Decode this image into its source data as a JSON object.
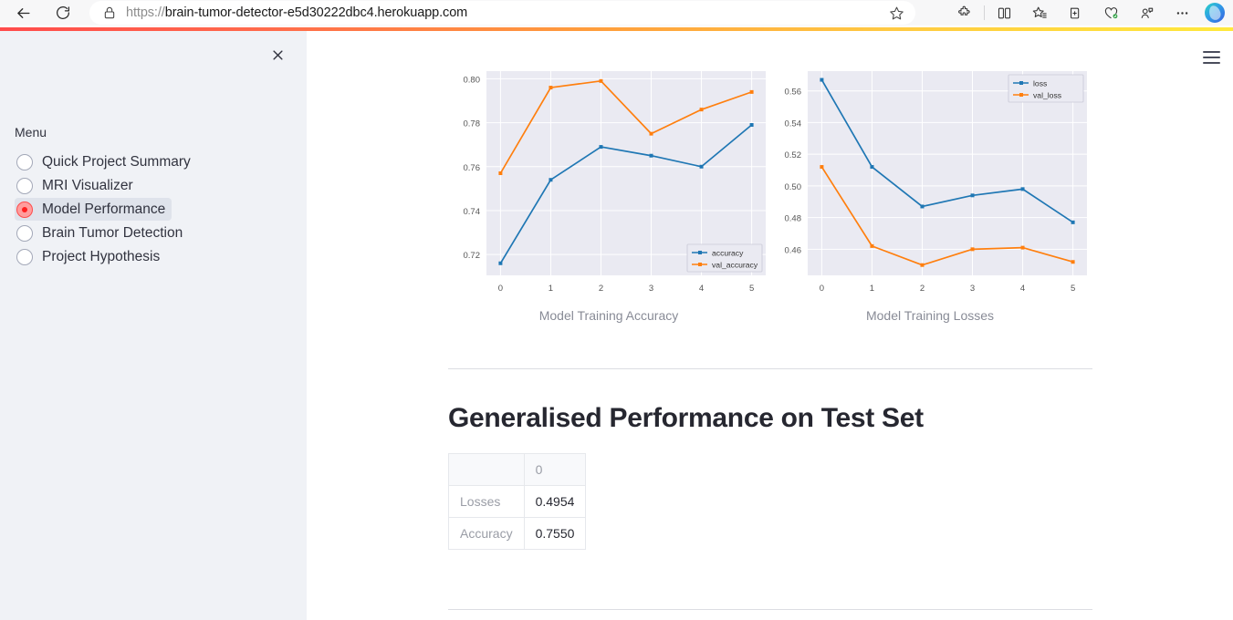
{
  "browser": {
    "url_scheme": "https://",
    "url_host": "brain-tumor-detector-e5d30222dbc4.herokuapp.com",
    "back_label": "Back",
    "reload_label": "Refresh",
    "lock_label": "Site information",
    "favorite_label": "Add this page to favorites",
    "icons": {
      "back": "back-arrow-icon",
      "reload": "reload-icon",
      "lock": "lock-icon",
      "star": "star-icon",
      "extensions": "puzzle-extensions-icon",
      "split_screen": "split-screen-icon",
      "favorites_list": "favorites-list-icon",
      "collections": "collections-add-icon",
      "browser_essentials": "browser-essentials-icon",
      "copilot_share": "copilot-share-icon",
      "settings_more": "ellipsis-more-icon",
      "copilot": "copilot-logo-icon"
    }
  },
  "sidebar": {
    "close_label": "×",
    "menu_label": "Menu",
    "items": [
      {
        "label": "Quick Project Summary",
        "selected": false
      },
      {
        "label": "MRI Visualizer",
        "selected": false
      },
      {
        "label": "Model Performance",
        "selected": true
      },
      {
        "label": "Brain Tumor Detection",
        "selected": false
      },
      {
        "label": "Project Hypothesis",
        "selected": false
      }
    ]
  },
  "main": {
    "hamburger_label": "Main menu",
    "section_title": "Generalised Performance on Test Set",
    "expand_icon": "fullscreen-expand-icon",
    "table": {
      "corner_header": "",
      "column_headers": [
        "0"
      ],
      "rows": [
        {
          "label": "Losses",
          "values": [
            "0.4954"
          ]
        },
        {
          "label": "Accuracy",
          "values": [
            "0.7550"
          ]
        }
      ]
    }
  },
  "colors": {
    "accent_red": "#ff4b4b",
    "series_blue": "#1f77b4",
    "series_orange": "#ff7f0e",
    "plot_bg": "#eaeaf2",
    "sidebar_bg": "#f0f2f6"
  },
  "chart_data": [
    {
      "type": "line",
      "title": "Model Training Accuracy",
      "caption": "Model Training Accuracy",
      "x": [
        0,
        1,
        2,
        3,
        4,
        5
      ],
      "xlabel": "",
      "ylabel": "",
      "xlim": [
        -0.28,
        5.28
      ],
      "ylim": [
        0.7105,
        0.8035
      ],
      "xticks": [
        "0",
        "1",
        "2",
        "3",
        "4",
        "5"
      ],
      "yticks": [
        "0.72",
        "0.74",
        "0.76",
        "0.78",
        "0.80"
      ],
      "ytick_values": [
        0.72,
        0.74,
        0.76,
        0.78,
        0.8
      ],
      "grid": true,
      "legend_position": "lower right",
      "series": [
        {
          "name": "accuracy",
          "color": "#1f77b4",
          "values": [
            0.716,
            0.754,
            0.769,
            0.765,
            0.76,
            0.779
          ]
        },
        {
          "name": "val_accuracy",
          "color": "#ff7f0e",
          "values": [
            0.757,
            0.796,
            0.799,
            0.775,
            0.786,
            0.794
          ]
        }
      ]
    },
    {
      "type": "line",
      "title": "Model Training Losses",
      "caption": "Model Training Losses",
      "x": [
        0,
        1,
        2,
        3,
        4,
        5
      ],
      "xlabel": "",
      "ylabel": "",
      "xlim": [
        -0.28,
        5.28
      ],
      "ylim": [
        0.4435,
        0.5725
      ],
      "xticks": [
        "0",
        "1",
        "2",
        "3",
        "4",
        "5"
      ],
      "yticks": [
        "0.46",
        "0.48",
        "0.50",
        "0.52",
        "0.54",
        "0.56"
      ],
      "ytick_values": [
        0.46,
        0.48,
        0.5,
        0.52,
        0.54,
        0.56
      ],
      "grid": true,
      "legend_position": "upper right",
      "series": [
        {
          "name": "loss",
          "color": "#1f77b4",
          "values": [
            0.567,
            0.512,
            0.487,
            0.494,
            0.498,
            0.477
          ]
        },
        {
          "name": "val_loss",
          "color": "#ff7f0e",
          "values": [
            0.512,
            0.462,
            0.45,
            0.46,
            0.461,
            0.452
          ]
        }
      ]
    }
  ]
}
